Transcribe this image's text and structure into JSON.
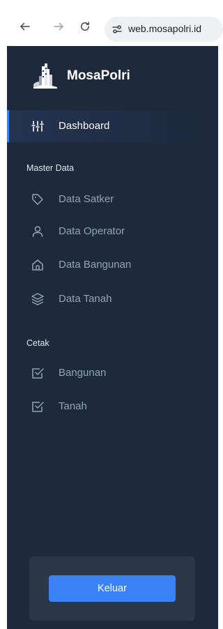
{
  "browser": {
    "url": "web.mosapolri.id",
    "icons": [
      "back-arrow-icon",
      "forward-arrow-icon",
      "reload-icon",
      "site-settings-icon"
    ]
  },
  "brand": {
    "name": "MosaPolri",
    "logo": "building-logo"
  },
  "colors": {
    "sidebar_bg": "#1e293b",
    "active_accent": "#3b82f6",
    "logout_button": "#3b82f6"
  },
  "menu": {
    "dashboard": {
      "label": "Dashboard",
      "icon": "sliders-icon",
      "active": true
    },
    "sections": [
      {
        "title": "Master Data",
        "items": [
          {
            "label": "Data Satker",
            "icon": "tag-icon"
          },
          {
            "label": "Data Operator",
            "icon": "user-icon"
          },
          {
            "label": "Data Bangunan",
            "icon": "home-icon"
          },
          {
            "label": "Data Tanah",
            "icon": "layers-icon"
          }
        ]
      },
      {
        "title": "Cetak",
        "items": [
          {
            "label": "Bangunan",
            "icon": "checkbox-icon"
          },
          {
            "label": "Tanah",
            "icon": "checkbox-icon"
          }
        ]
      }
    ]
  },
  "footer": {
    "logout_label": "Keluar"
  }
}
